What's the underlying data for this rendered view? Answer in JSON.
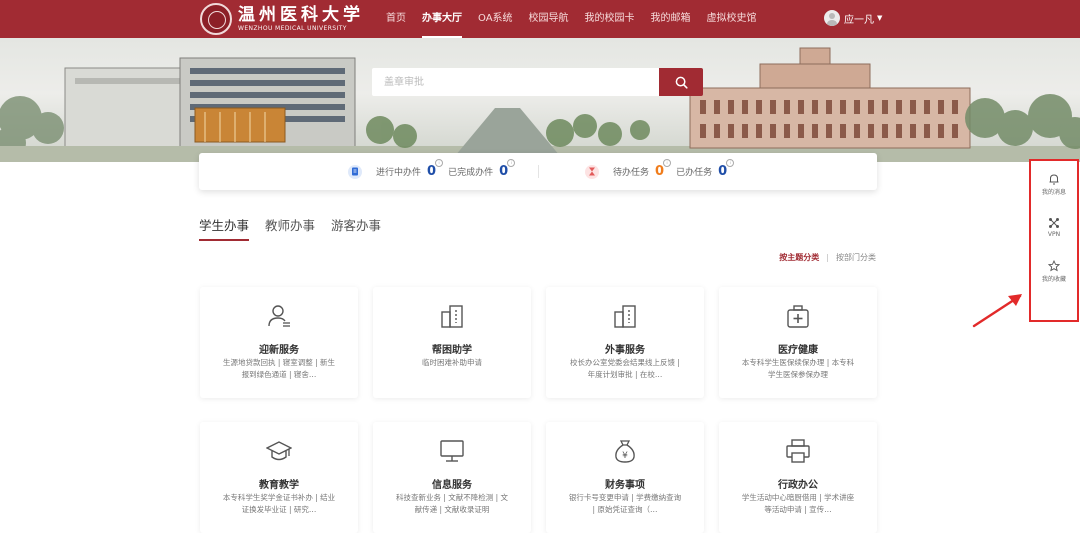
{
  "header": {
    "logo_cn": "温州医科大学",
    "logo_en": "WENZHOU MEDICAL UNIVERSITY",
    "nav": [
      {
        "label": "首页",
        "active": false
      },
      {
        "label": "办事大厅",
        "active": true
      },
      {
        "label": "OA系统",
        "active": false
      },
      {
        "label": "校园导航",
        "active": false
      },
      {
        "label": "我的校园卡",
        "active": false
      },
      {
        "label": "我的邮箱",
        "active": false
      },
      {
        "label": "虚拟校史馆",
        "active": false
      }
    ],
    "user_name": "应一凡"
  },
  "search": {
    "placeholder": "盖章审批"
  },
  "stats": {
    "in_progress_label": "进行中办件",
    "in_progress_value": "0",
    "completed_label": "已完成办件",
    "completed_value": "0",
    "pending_label": "待办任务",
    "pending_value": "0",
    "done_label": "已办任务",
    "done_value": "0"
  },
  "tabs": [
    {
      "label": "学生办事",
      "active": true
    },
    {
      "label": "教师办事",
      "active": false
    },
    {
      "label": "游客办事",
      "active": false
    }
  ],
  "sort": {
    "by_topic": "按主题分类",
    "by_department": "按部门分类"
  },
  "cards": [
    {
      "icon": "user-add-icon",
      "title": "迎新服务",
      "desc": "生源地贷款回执 | 寝室调整 | 新生报到绿色通道 | 寝舍…"
    },
    {
      "icon": "building-icon",
      "title": "帮困助学",
      "desc": "临时困难补助申请"
    },
    {
      "icon": "building-icon",
      "title": "外事服务",
      "desc": "校长办公室党委会结果线上反馈 | 年度计划审批 | 在校…"
    },
    {
      "icon": "medical-kit-icon",
      "title": "医疗健康",
      "desc": "本专科学生医保续保办理 | 本专科学生医保参保办理"
    },
    {
      "icon": "graduation-cap-icon",
      "title": "教育教学",
      "desc": "本专科学生奖学金证书补办 | 结业证换发毕业证 | 研究…"
    },
    {
      "icon": "monitor-icon",
      "title": "信息服务",
      "desc": "科技查新业务 | 文献不降检测 | 文献传递 | 文献收录证明"
    },
    {
      "icon": "money-bag-icon",
      "title": "财务事项",
      "desc": "银行卡号变更申请 | 学费缴纳查询 | 原始凭证查询（…"
    },
    {
      "icon": "printer-icon",
      "title": "行政办公",
      "desc": "学生活动中心暗厨借用 | 学术讲座等活动申请 | 宣传…"
    }
  ],
  "side": {
    "messages": "我的消息",
    "vpn": "VPN",
    "favorites": "我的收藏"
  },
  "colors": {
    "brand": "#a12b33",
    "stat_blue": "#1f4ea8",
    "stat_orange": "#f07c1b",
    "annotation_red": "#e22a2a"
  }
}
